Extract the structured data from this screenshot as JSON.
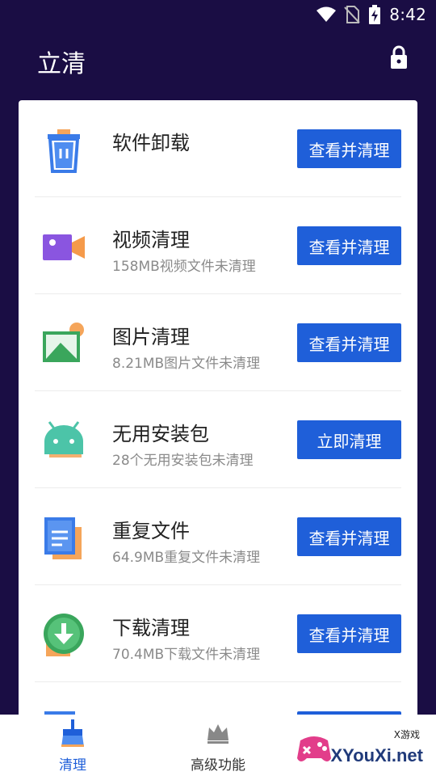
{
  "status": {
    "time": "8:42"
  },
  "app": {
    "title": "立清"
  },
  "rows": [
    {
      "title": "软件卸载",
      "subtitle": "",
      "button": "查看并清理",
      "icon": "trash-icon"
    },
    {
      "title": "视频清理",
      "subtitle": "158MB视频文件未清理",
      "button": "查看并清理",
      "icon": "video-icon"
    },
    {
      "title": "图片清理",
      "subtitle": "8.21MB图片文件未清理",
      "button": "查看并清理",
      "icon": "image-icon"
    },
    {
      "title": "无用安装包",
      "subtitle": "28个无用安装包未清理",
      "button": "立即清理",
      "icon": "android-icon"
    },
    {
      "title": "重复文件",
      "subtitle": "64.9MB重复文件未清理",
      "button": "查看并清理",
      "icon": "document-icon"
    },
    {
      "title": "下载清理",
      "subtitle": "70.4MB下载文件未清理",
      "button": "查看并清理",
      "icon": "download-icon"
    }
  ],
  "nav": [
    {
      "label": "清理",
      "icon": "broom-icon",
      "active": true
    },
    {
      "label": "高级功能",
      "icon": "crown-icon",
      "active": false
    }
  ],
  "watermark": {
    "small": "X游戏",
    "main": "XYouXi.net"
  },
  "colors": {
    "background": "#1a0d44",
    "accent": "#1f5fd9"
  }
}
